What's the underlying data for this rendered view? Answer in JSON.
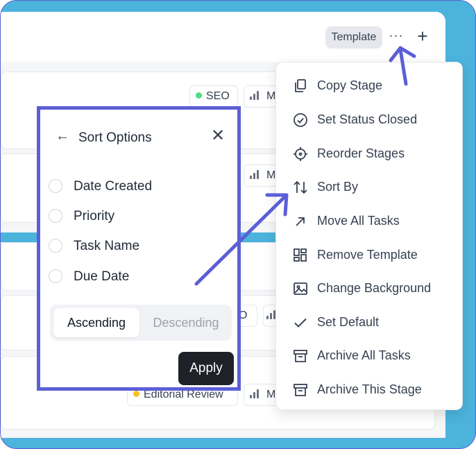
{
  "toolbar": {
    "template_label": "Template",
    "more_glyph": "···",
    "add_glyph": "+"
  },
  "board": {
    "chips": {
      "seo": "SEO",
      "m1": "M",
      "m2": "M",
      "o": "O",
      "editorial": "Editorial Review",
      "m4": "M"
    },
    "colors": {
      "seo_dot": "#4ade80",
      "editorial_dot": "#fbbf24",
      "stage_accent": "#4bb3dc"
    }
  },
  "sort_panel": {
    "back_glyph": "←",
    "title": "Sort Options",
    "close_glyph": "✕",
    "options": [
      "Date Created",
      "Priority",
      "Task Name",
      "Due Date"
    ],
    "order": {
      "ascending": "Ascending",
      "descending": "Descending",
      "selected": "Ascending"
    },
    "apply_label": "Apply"
  },
  "menu": {
    "items": [
      {
        "label": "Copy Stage",
        "icon": "copy-icon"
      },
      {
        "label": "Set Status Closed",
        "icon": "check-circle-icon"
      },
      {
        "label": "Reorder Stages",
        "icon": "crosshair-icon"
      },
      {
        "label": "Sort By",
        "icon": "sort-arrows-icon"
      },
      {
        "label": "Move All Tasks",
        "icon": "arrow-up-right-icon"
      },
      {
        "label": "Remove Template",
        "icon": "layout-icon"
      },
      {
        "label": "Change Background",
        "icon": "image-icon"
      },
      {
        "label": "Set Default",
        "icon": "check-icon"
      },
      {
        "label": "Archive All Tasks",
        "icon": "archive-icon"
      },
      {
        "label": "Archive This Stage",
        "icon": "archive-icon"
      }
    ]
  },
  "annotation": {
    "color": "#5b5fd6"
  }
}
